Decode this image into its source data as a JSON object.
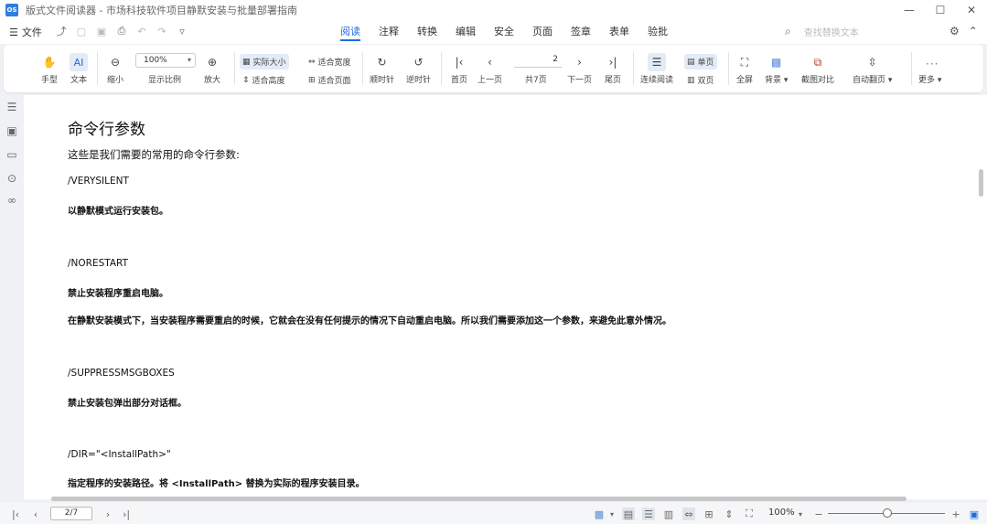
{
  "titlebar": {
    "logo_text": "OS",
    "title": "版式文件阅读器 - 市场科技软件项目静默安装与批量部署指南",
    "controls": [
      "—",
      "☐",
      "✕"
    ]
  },
  "menubar": {
    "file_label": "文件",
    "tabs": [
      "阅读",
      "注释",
      "转换",
      "编辑",
      "安全",
      "页面",
      "签章",
      "表单",
      "验批"
    ],
    "active_tab": "阅读",
    "search_placeholder": "查找替换文本"
  },
  "toolbar": {
    "hand": "手型",
    "text_select": "文本",
    "zoom_out": "缩小",
    "zoom_value": "100%",
    "zoom_label": "显示比例",
    "zoom_in": "放大",
    "actual_size": "实际大小",
    "fit_width": "适合宽度",
    "fit_height": "适合高度",
    "fit_page": "适合页面",
    "rotate_cw": "顺时针",
    "rotate_ccw": "逆时针",
    "first_page": "首页",
    "prev_page": "上一页",
    "page_value": "2",
    "page_total": "共7页",
    "next_page": "下一页",
    "last_page": "尾页",
    "continuous_read": "连续阅读",
    "single_page": "单页",
    "double_page": "双页",
    "fullscreen": "全屏",
    "background": "背景",
    "screenshot_compare": "截图对比",
    "auto_scroll": "自动翻页",
    "more": "更多"
  },
  "document": {
    "heading": "命令行参数",
    "intro": "这些是我们需要的常用的命令行参数:",
    "blocks": [
      {
        "cmd": "/VERYSILENT",
        "lines": [
          "以静默模式运行安装包。"
        ]
      },
      {
        "cmd": "/NORESTART",
        "lines": [
          "禁止安装程序重启电脑。",
          "在静默安装模式下，当安装程序需要重启的时候，它就会在没有任何提示的情况下自动重启电脑。所以我们需要添加这一个参数，来避免此意外情况。"
        ]
      },
      {
        "cmd": "/SUPPRESSMSGBOXES",
        "lines": [
          "禁止安装包弹出部分对话框。"
        ]
      },
      {
        "cmd": "/DIR=\"<InstallPath>\"",
        "lines": [
          "指定程序的安装路径。将 <InstallPath> 替换为实际的程序安装目录。"
        ]
      }
    ]
  },
  "statusbar": {
    "page_indicator": "2/7",
    "zoom": "100%"
  },
  "colors": {
    "accent": "#1f6ce0",
    "active_bg": "#e3ebf7"
  }
}
